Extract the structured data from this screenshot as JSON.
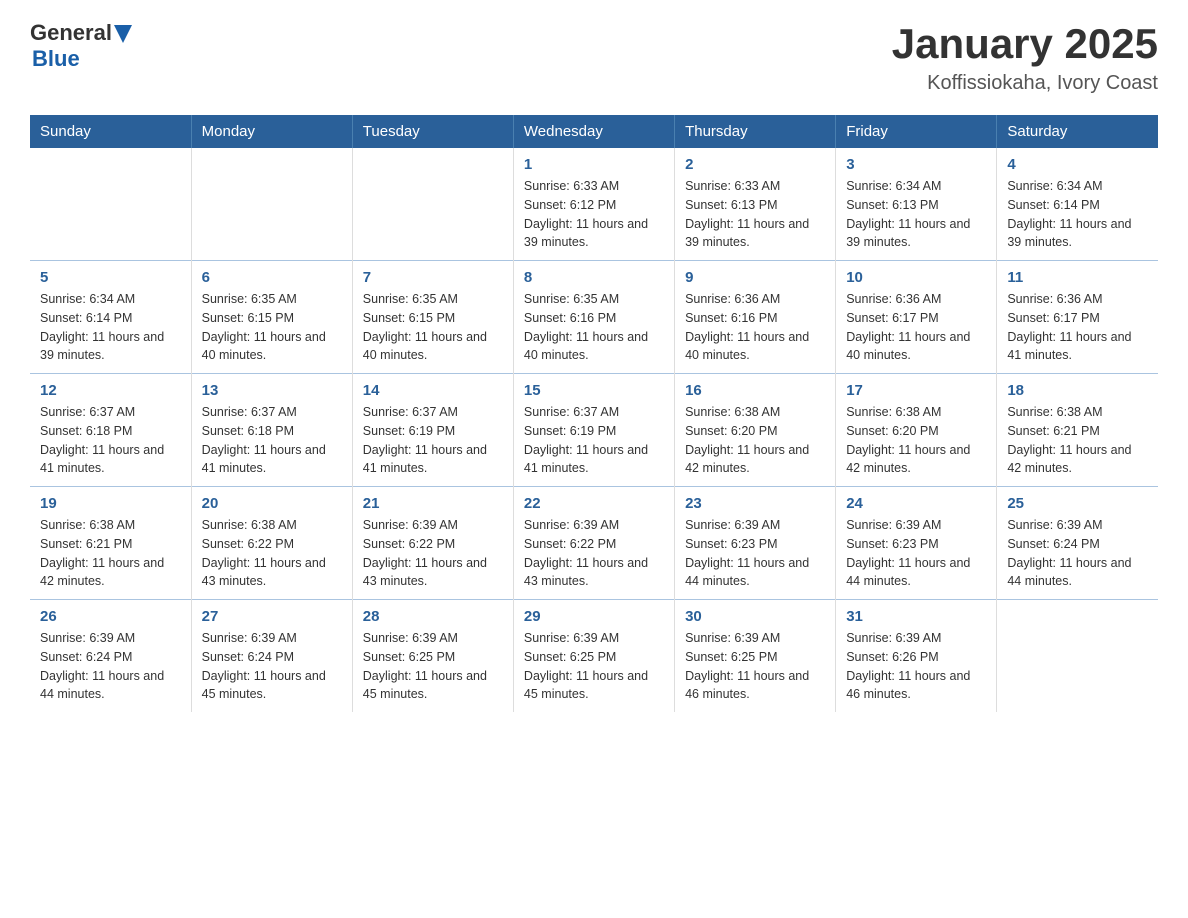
{
  "header": {
    "logo_general": "General",
    "logo_blue": "Blue",
    "title": "January 2025",
    "subtitle": "Koffissiokaha, Ivory Coast"
  },
  "days_of_week": [
    "Sunday",
    "Monday",
    "Tuesday",
    "Wednesday",
    "Thursday",
    "Friday",
    "Saturday"
  ],
  "weeks": [
    {
      "days": [
        {
          "num": "",
          "info": ""
        },
        {
          "num": "",
          "info": ""
        },
        {
          "num": "",
          "info": ""
        },
        {
          "num": "1",
          "info": "Sunrise: 6:33 AM\nSunset: 6:12 PM\nDaylight: 11 hours and 39 minutes."
        },
        {
          "num": "2",
          "info": "Sunrise: 6:33 AM\nSunset: 6:13 PM\nDaylight: 11 hours and 39 minutes."
        },
        {
          "num": "3",
          "info": "Sunrise: 6:34 AM\nSunset: 6:13 PM\nDaylight: 11 hours and 39 minutes."
        },
        {
          "num": "4",
          "info": "Sunrise: 6:34 AM\nSunset: 6:14 PM\nDaylight: 11 hours and 39 minutes."
        }
      ]
    },
    {
      "days": [
        {
          "num": "5",
          "info": "Sunrise: 6:34 AM\nSunset: 6:14 PM\nDaylight: 11 hours and 39 minutes."
        },
        {
          "num": "6",
          "info": "Sunrise: 6:35 AM\nSunset: 6:15 PM\nDaylight: 11 hours and 40 minutes."
        },
        {
          "num": "7",
          "info": "Sunrise: 6:35 AM\nSunset: 6:15 PM\nDaylight: 11 hours and 40 minutes."
        },
        {
          "num": "8",
          "info": "Sunrise: 6:35 AM\nSunset: 6:16 PM\nDaylight: 11 hours and 40 minutes."
        },
        {
          "num": "9",
          "info": "Sunrise: 6:36 AM\nSunset: 6:16 PM\nDaylight: 11 hours and 40 minutes."
        },
        {
          "num": "10",
          "info": "Sunrise: 6:36 AM\nSunset: 6:17 PM\nDaylight: 11 hours and 40 minutes."
        },
        {
          "num": "11",
          "info": "Sunrise: 6:36 AM\nSunset: 6:17 PM\nDaylight: 11 hours and 41 minutes."
        }
      ]
    },
    {
      "days": [
        {
          "num": "12",
          "info": "Sunrise: 6:37 AM\nSunset: 6:18 PM\nDaylight: 11 hours and 41 minutes."
        },
        {
          "num": "13",
          "info": "Sunrise: 6:37 AM\nSunset: 6:18 PM\nDaylight: 11 hours and 41 minutes."
        },
        {
          "num": "14",
          "info": "Sunrise: 6:37 AM\nSunset: 6:19 PM\nDaylight: 11 hours and 41 minutes."
        },
        {
          "num": "15",
          "info": "Sunrise: 6:37 AM\nSunset: 6:19 PM\nDaylight: 11 hours and 41 minutes."
        },
        {
          "num": "16",
          "info": "Sunrise: 6:38 AM\nSunset: 6:20 PM\nDaylight: 11 hours and 42 minutes."
        },
        {
          "num": "17",
          "info": "Sunrise: 6:38 AM\nSunset: 6:20 PM\nDaylight: 11 hours and 42 minutes."
        },
        {
          "num": "18",
          "info": "Sunrise: 6:38 AM\nSunset: 6:21 PM\nDaylight: 11 hours and 42 minutes."
        }
      ]
    },
    {
      "days": [
        {
          "num": "19",
          "info": "Sunrise: 6:38 AM\nSunset: 6:21 PM\nDaylight: 11 hours and 42 minutes."
        },
        {
          "num": "20",
          "info": "Sunrise: 6:38 AM\nSunset: 6:22 PM\nDaylight: 11 hours and 43 minutes."
        },
        {
          "num": "21",
          "info": "Sunrise: 6:39 AM\nSunset: 6:22 PM\nDaylight: 11 hours and 43 minutes."
        },
        {
          "num": "22",
          "info": "Sunrise: 6:39 AM\nSunset: 6:22 PM\nDaylight: 11 hours and 43 minutes."
        },
        {
          "num": "23",
          "info": "Sunrise: 6:39 AM\nSunset: 6:23 PM\nDaylight: 11 hours and 44 minutes."
        },
        {
          "num": "24",
          "info": "Sunrise: 6:39 AM\nSunset: 6:23 PM\nDaylight: 11 hours and 44 minutes."
        },
        {
          "num": "25",
          "info": "Sunrise: 6:39 AM\nSunset: 6:24 PM\nDaylight: 11 hours and 44 minutes."
        }
      ]
    },
    {
      "days": [
        {
          "num": "26",
          "info": "Sunrise: 6:39 AM\nSunset: 6:24 PM\nDaylight: 11 hours and 44 minutes."
        },
        {
          "num": "27",
          "info": "Sunrise: 6:39 AM\nSunset: 6:24 PM\nDaylight: 11 hours and 45 minutes."
        },
        {
          "num": "28",
          "info": "Sunrise: 6:39 AM\nSunset: 6:25 PM\nDaylight: 11 hours and 45 minutes."
        },
        {
          "num": "29",
          "info": "Sunrise: 6:39 AM\nSunset: 6:25 PM\nDaylight: 11 hours and 45 minutes."
        },
        {
          "num": "30",
          "info": "Sunrise: 6:39 AM\nSunset: 6:25 PM\nDaylight: 11 hours and 46 minutes."
        },
        {
          "num": "31",
          "info": "Sunrise: 6:39 AM\nSunset: 6:26 PM\nDaylight: 11 hours and 46 minutes."
        },
        {
          "num": "",
          "info": ""
        }
      ]
    }
  ]
}
